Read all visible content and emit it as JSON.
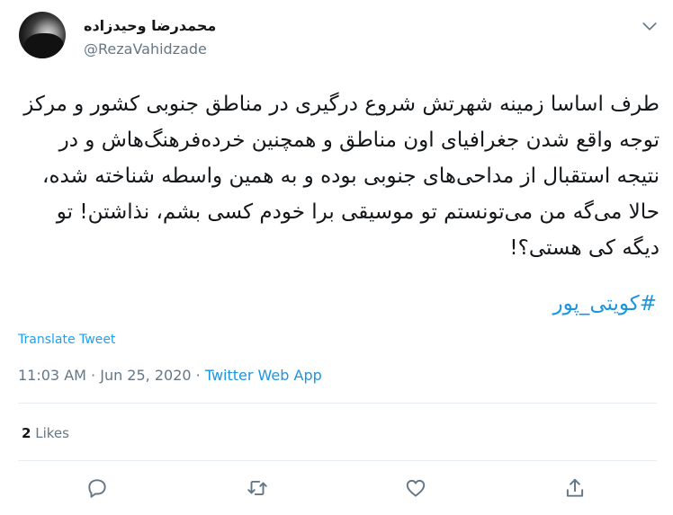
{
  "author": {
    "display_name": "محمدرضا وحیدزاده",
    "handle": "@RezaVahidzade"
  },
  "tweet": {
    "text": "طرف اساسا زمینه شهرتش شروع درگیری  در مناطق جنوبی کشور و مرکز توجه واقع شدن جغرافیای اون مناطق و همچنین خرده‌فرهنگ‌هاش و در نتیجه استقبال از مداحی‌های جنوبی بوده و به همین واسطه شناخته شده، حالا می‌گه من می‌تونستم تو موسیقی برا خودم کسی بشم، نذاشتن! تو دیگه کی هستی؟!",
    "hashtag": "#کویتی_پور",
    "translate_label": "Translate Tweet"
  },
  "meta": {
    "time": "11:03 AM",
    "separator1": " · ",
    "date": "Jun 25, 2020",
    "separator2": " · ",
    "source": "Twitter Web App"
  },
  "stats": {
    "likes_count": "2",
    "likes_label": "Likes"
  },
  "icons": {
    "caret": "chevron-down-icon",
    "reply": "reply-icon",
    "retweet": "retweet-icon",
    "like": "heart-icon",
    "share": "share-icon"
  },
  "colors": {
    "link": "#1b95e0",
    "muted": "#657786",
    "text": "#14171a",
    "divider": "#e6ecf0"
  }
}
